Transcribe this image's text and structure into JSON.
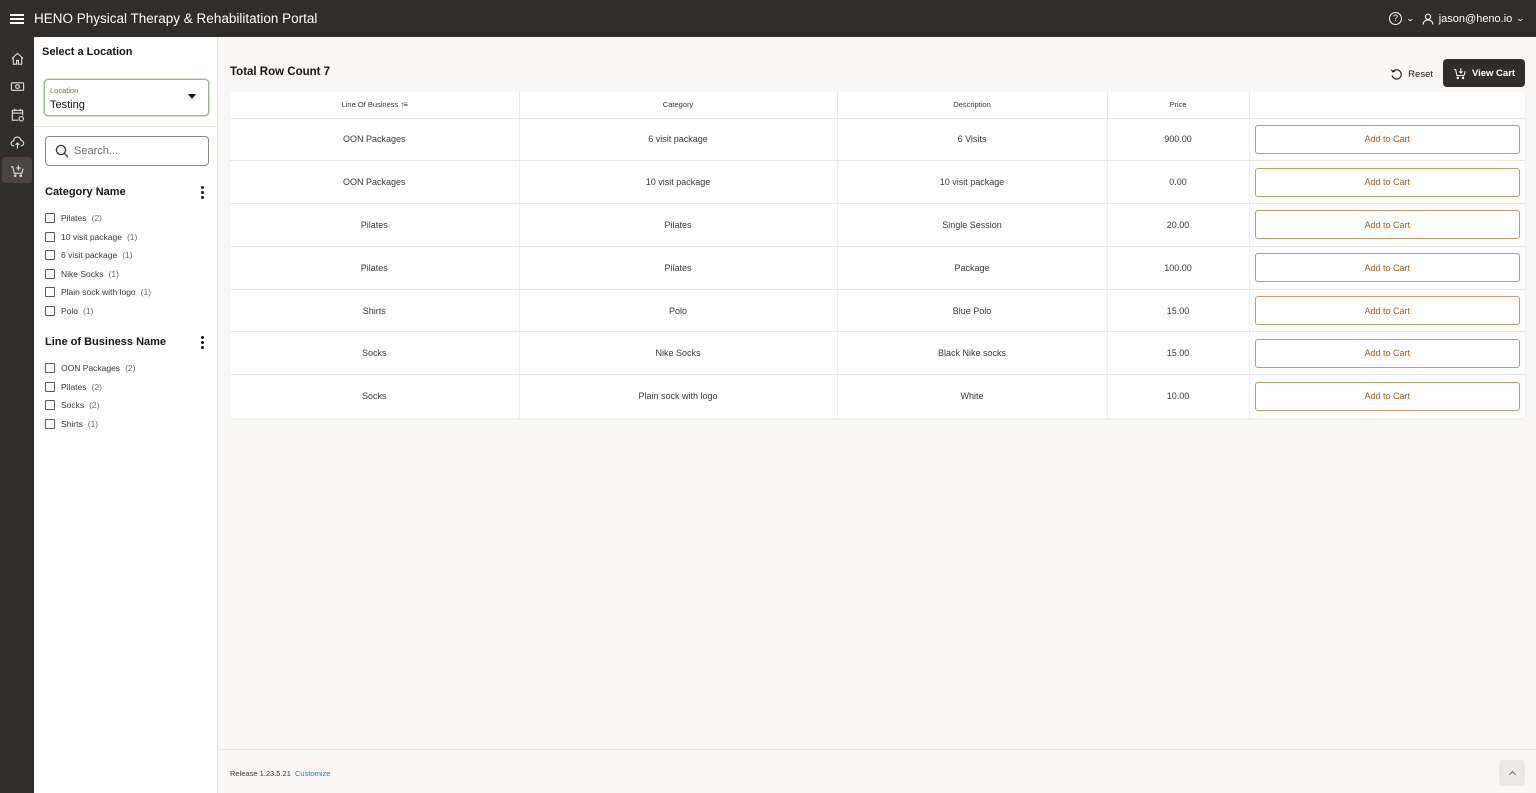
{
  "header": {
    "app_title": "HENO Physical Therapy & Rehabilitation Portal",
    "help_icon_glyph": "?",
    "user_email": "jason@heno.io"
  },
  "icon_rail": [
    {
      "icon": "home-icon",
      "active": false
    },
    {
      "icon": "money-icon",
      "active": false
    },
    {
      "icon": "calendar-icon",
      "active": false
    },
    {
      "icon": "cloud-upload-icon",
      "active": false
    },
    {
      "icon": "cart-add-icon",
      "active": true
    }
  ],
  "left_panel": {
    "title": "Select a Location",
    "location_select": {
      "label": "Location",
      "value": "Testing"
    },
    "search": {
      "placeholder": "Search...",
      "value": ""
    },
    "facets": [
      {
        "title": "Category Name",
        "items": [
          {
            "label": "Pilates",
            "count": "(2)",
            "checked": false
          },
          {
            "label": "10 visit package",
            "count": "(1)",
            "checked": false
          },
          {
            "label": "6 visit package",
            "count": "(1)",
            "checked": false
          },
          {
            "label": "Nike Socks",
            "count": "(1)",
            "checked": false
          },
          {
            "label": "Plain sock with logo",
            "count": "(1)",
            "checked": false
          },
          {
            "label": "Polo",
            "count": "(1)",
            "checked": false
          }
        ]
      },
      {
        "title": "Line of Business Name",
        "items": [
          {
            "label": "OON Packages",
            "count": "(2)",
            "checked": false
          },
          {
            "label": "Pilates",
            "count": "(2)",
            "checked": false
          },
          {
            "label": "Socks",
            "count": "(2)",
            "checked": false
          },
          {
            "label": "Shirts",
            "count": "(1)",
            "checked": false
          }
        ]
      }
    ]
  },
  "main": {
    "row_count_label": "Total Row Count 7",
    "reset_label": "Reset",
    "view_cart_label": "View Cart",
    "table": {
      "columns": [
        "Line Of Business",
        "Category",
        "Description",
        "Price",
        ""
      ],
      "sort_column": "Line Of Business",
      "sort_direction": "ascending",
      "rows": [
        {
          "line_of_business": "OON Packages",
          "category": "6 visit package",
          "description": "6 Visits",
          "price": "900.00",
          "action": "Add to Cart"
        },
        {
          "line_of_business": "OON Packages",
          "category": "10 visit package",
          "description": "10 visit package",
          "price": "0.00",
          "action": "Add to Cart"
        },
        {
          "line_of_business": "Pilates",
          "category": "Pilates",
          "description": "Single Session",
          "price": "20.00",
          "action": "Add to Cart"
        },
        {
          "line_of_business": "Pilates",
          "category": "Pilates",
          "description": "Package",
          "price": "100.00",
          "action": "Add to Cart"
        },
        {
          "line_of_business": "Shirts",
          "category": "Polo",
          "description": "Blue Polo",
          "price": "15.00",
          "action": "Add to Cart"
        },
        {
          "line_of_business": "Socks",
          "category": "Nike Socks",
          "description": "Black Nike socks",
          "price": "15.00",
          "action": "Add to Cart"
        },
        {
          "line_of_business": "Socks",
          "category": "Plain sock with logo",
          "description": "White",
          "price": "10.00",
          "action": "Add to Cart"
        }
      ]
    }
  },
  "footer": {
    "release": "Release 1.23.5.21",
    "customize_link": "Customize"
  },
  "colors": {
    "header_bg": "#312d2a",
    "accent_button_text": "#a25b1d",
    "accent_button_border": "#c99466",
    "link": "#2b78a8",
    "location_focus": "#9bb592"
  }
}
